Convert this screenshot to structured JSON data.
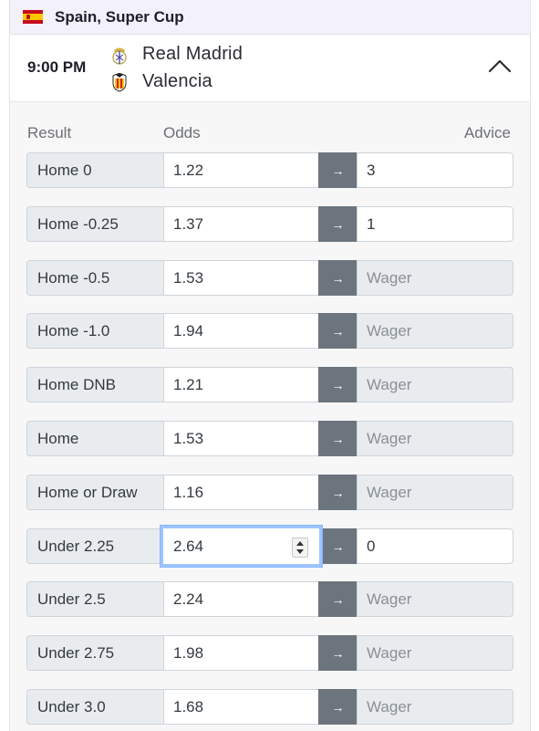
{
  "league": {
    "name": "Spain, Super Cup",
    "flag_icon": "spain-flag-icon"
  },
  "match": {
    "time": "9:00 PM",
    "home_team": "Real Madrid",
    "away_team": "Valencia",
    "home_logo_icon": "real-madrid-crest-icon",
    "away_logo_icon": "valencia-crest-icon",
    "collapse_icon": "chevron-up-icon"
  },
  "table": {
    "headers": {
      "result": "Result",
      "odds": "Odds",
      "advice": "Advice"
    },
    "arrow_symbol": "→",
    "advice_placeholder": "Wager",
    "rows": [
      {
        "result": "Home 0",
        "odds": "1.22",
        "advice": "3"
      },
      {
        "result": "Home -0.25",
        "odds": "1.37",
        "advice": "1"
      },
      {
        "result": "Home -0.5",
        "odds": "1.53",
        "advice": ""
      },
      {
        "result": "Home -1.0",
        "odds": "1.94",
        "advice": ""
      },
      {
        "result": "Home DNB",
        "odds": "1.21",
        "advice": ""
      },
      {
        "result": "Home",
        "odds": "1.53",
        "advice": ""
      },
      {
        "result": "Home or Draw",
        "odds": "1.16",
        "advice": ""
      },
      {
        "result": "Under 2.25",
        "odds": "2.64",
        "advice": "0"
      },
      {
        "result": "Under 2.5",
        "odds": "2.24",
        "advice": ""
      },
      {
        "result": "Under 2.75",
        "odds": "1.98",
        "advice": ""
      },
      {
        "result": "Under 3.0",
        "odds": "1.68",
        "advice": ""
      }
    ]
  },
  "colors": {
    "league_bar_bg": "#f3f2fb",
    "arrow_button_bg": "#6c757d",
    "result_cell_bg": "#e9ecef",
    "focus_ring": "#9ec5fe"
  }
}
